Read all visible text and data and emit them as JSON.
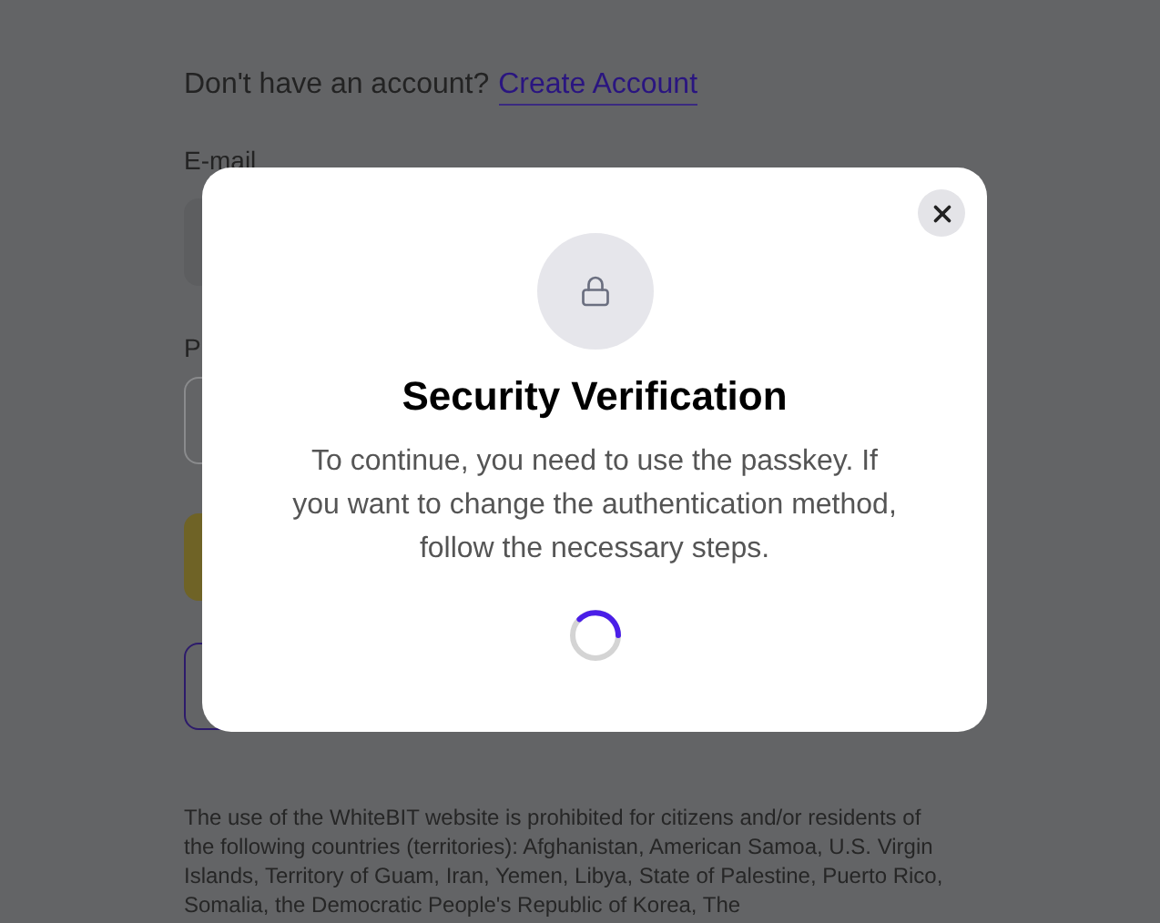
{
  "signup_prompt": {
    "text": "Don't have an account?",
    "link": "Create Account"
  },
  "email": {
    "label": "E-mail"
  },
  "password": {
    "label": "P"
  },
  "disclaimer": "The use of the WhiteBIT website is prohibited for citizens and/or residents of the following countries (territories): Afghanistan, American Samoa, U.S. Virgin Islands, Territory of Guam, Iran, Yemen, Libya, State of Palestine, Puerto Rico, Somalia, the Democratic People's Republic of Korea, The",
  "dialog": {
    "title": "Security Verification",
    "message": "To continue, you need to use the passkey. If you want to change the authentication method, follow the necessary steps.",
    "loading": true
  }
}
